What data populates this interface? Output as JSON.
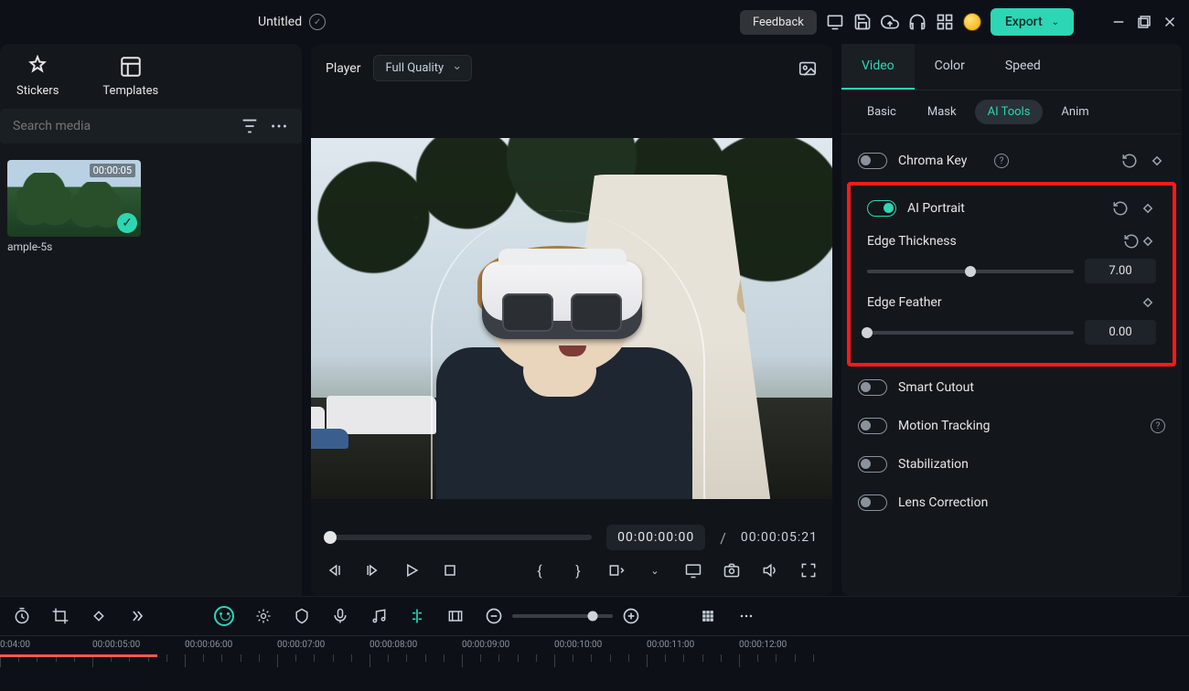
{
  "app": {
    "doc_title": "Untitled"
  },
  "topbar": {
    "feedback": "Feedback",
    "export": "Export"
  },
  "left": {
    "tab_stickers": "Stickers",
    "tab_templates": "Templates",
    "search_placeholder": "Search media",
    "clip": {
      "duration": "00:00:05",
      "name": "ample-5s"
    }
  },
  "player": {
    "label": "Player",
    "quality": "Full Quality",
    "current_tc": "00:00:00:00",
    "total_tc": "00:00:05:21",
    "separator": "/"
  },
  "inspector": {
    "tabs": {
      "video": "Video",
      "color": "Color",
      "speed": "Speed"
    },
    "subtabs": {
      "basic": "Basic",
      "mask": "Mask",
      "ai_tools": "AI Tools",
      "anim": "Anim"
    },
    "chroma_key": "Chroma Key",
    "ai_portrait": "AI Portrait",
    "edge_thickness": {
      "label": "Edge Thickness",
      "value": "7.00",
      "pct": 50
    },
    "edge_feather": {
      "label": "Edge Feather",
      "value": "0.00",
      "pct": 0
    },
    "smart_cutout": "Smart Cutout",
    "motion_tracking": "Motion Tracking",
    "stabilization": "Stabilization",
    "lens_correction": "Lens Correction"
  },
  "timeline": {
    "marks": [
      "0:04:00",
      "00:00:05:00",
      "00:00:06:00",
      "00:00:07:00",
      "00:00:08:00",
      "00:00:09:00",
      "00:00:10:00",
      "00:00:11:00",
      "00:00:12:00"
    ]
  }
}
